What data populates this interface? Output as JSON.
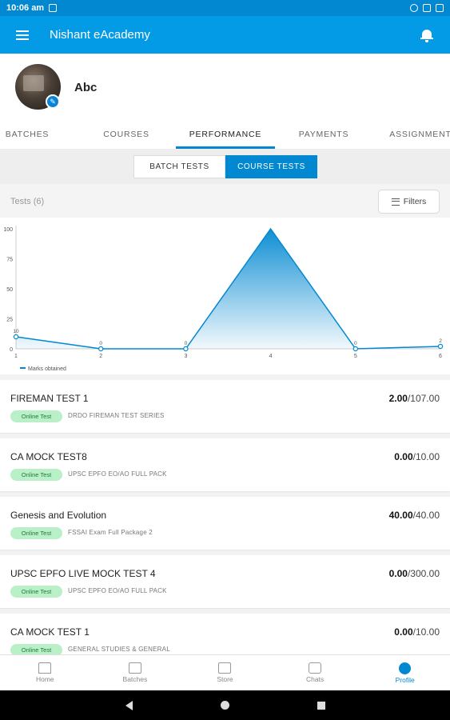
{
  "status_bar": {
    "time": "10:06 am"
  },
  "app_bar": {
    "title": "Nishant eAcademy"
  },
  "profile": {
    "name": "Abc"
  },
  "tabs": [
    {
      "label": "BATCHES"
    },
    {
      "label": "COURSES"
    },
    {
      "label": "PERFORMANCE"
    },
    {
      "label": "PAYMENTS"
    },
    {
      "label": "ASSIGNMENT"
    }
  ],
  "segments": {
    "batch_tests": "BATCH TESTS",
    "course_tests": "COURSE TESTS"
  },
  "tests_header": {
    "count_label": "Tests (6)",
    "filters_label": "Filters"
  },
  "colors": {
    "primary": "#0288d1",
    "app_bar": "#039be5",
    "tag_bg": "#b9f0c8"
  },
  "chart_data": {
    "type": "area",
    "x": [
      1,
      2,
      3,
      4,
      5,
      6
    ],
    "series": [
      {
        "name": "Marks obtained",
        "values": [
          10,
          0,
          0,
          100,
          0,
          2
        ]
      }
    ],
    "point_labels": [
      "10",
      "0",
      "0",
      "",
      "0",
      "2"
    ],
    "y_ticks": [
      "0",
      "25",
      "50",
      "75",
      "100"
    ],
    "x_ticks": [
      "1",
      "2",
      "3",
      "4",
      "5",
      "6"
    ],
    "ylim": [
      0,
      100
    ],
    "legend": "bottom-left"
  },
  "tests": [
    {
      "title": "FIREMAN TEST 1",
      "score": "2.00",
      "total": "/107.00",
      "tag": "Online Test",
      "course": "DRDO FIREMAN TEST SERIES"
    },
    {
      "title": "CA MOCK TEST8",
      "score": "0.00",
      "total": "/10.00",
      "tag": "Online Test",
      "course": "UPSC EPFO EO/AO FULL PACK"
    },
    {
      "title": "Genesis and Evolution",
      "score": "40.00",
      "total": "/40.00",
      "tag": "Online Test",
      "course": "FSSAI Exam Full Package 2"
    },
    {
      "title": "UPSC EPFO LIVE MOCK TEST 4",
      "score": "0.00",
      "total": "/300.00",
      "tag": "Online Test",
      "course": "UPSC EPFO EO/AO FULL PACK"
    },
    {
      "title": "CA MOCK TEST 1",
      "score": "0.00",
      "total": "/10.00",
      "tag": "Online Test",
      "course": "GENERAL STUDIES & GENERAL"
    }
  ],
  "bottom_nav": [
    {
      "label": "Home",
      "icon": "home-icon"
    },
    {
      "label": "Batches",
      "icon": "batches-icon"
    },
    {
      "label": "Store",
      "icon": "store-icon"
    },
    {
      "label": "Chats",
      "icon": "chats-icon"
    },
    {
      "label": "Profile",
      "icon": "profile-icon"
    }
  ]
}
